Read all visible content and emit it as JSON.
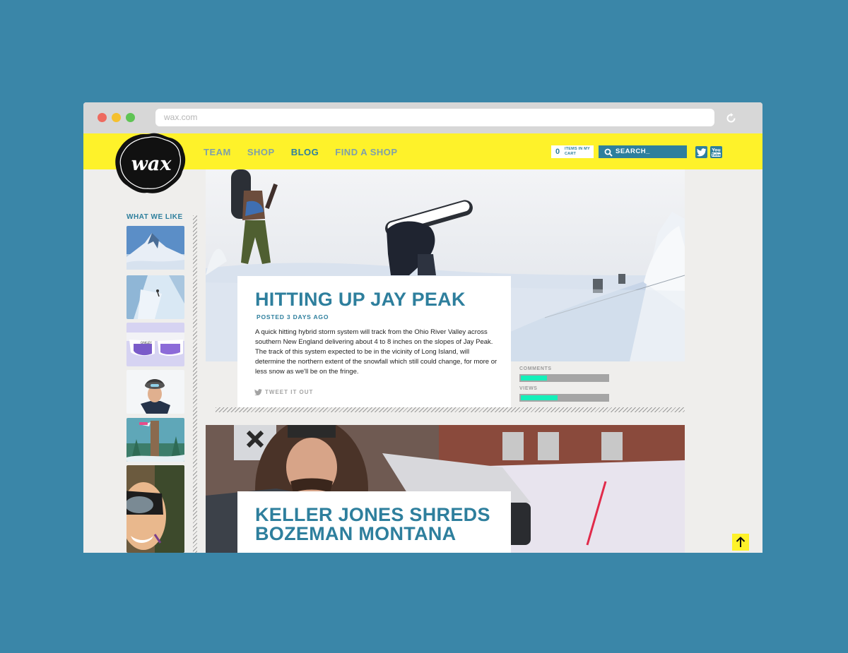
{
  "browser": {
    "url": "wax.com"
  },
  "header": {
    "logo_text": "wax",
    "nav": [
      {
        "label": "TEAM",
        "active": false
      },
      {
        "label": "SHOP",
        "active": false
      },
      {
        "label": "BLOG",
        "active": true
      },
      {
        "label": "FIND A SHOP",
        "active": false
      }
    ],
    "cart": {
      "count": "0",
      "label": "ITEMS IN MY CART"
    },
    "search": {
      "placeholder": "SEARCH_"
    },
    "social": [
      "twitter-icon",
      "youtube-icon"
    ]
  },
  "sidebar": {
    "title": "WHAT WE LIKE",
    "thumbnails": [
      "mountain-peak",
      "skier-on-slope",
      "oakley-sunglasses",
      "snowboarder-portrait",
      "snowboarder-in-trees",
      "goggles-closeup"
    ]
  },
  "posts": [
    {
      "title": "HITTING UP JAY PEAK",
      "meta": "POSTED 3 DAYS AGO",
      "body": "A quick hitting hybrid storm system will track from the Ohio River Valley across southern New England delivering about 4 to 8 inches on the slopes of Jay Peak. The track of this system expected to be in the vicinity of Long Island, will determine the northern extent of the snowfall which still could change, for more or less snow as we'll be on the fringe.",
      "tweet_label": "TWEET IT OUT",
      "stats": {
        "comments_label": "COMMENTS",
        "comments_fill": 0.3,
        "views_label": "VIEWS",
        "views_fill": 0.42
      }
    },
    {
      "title_line1": "KELLER JONES SHREDS",
      "title_line2": "BOZEMAN MONTANA"
    }
  ],
  "colors": {
    "background": "#3a86a8",
    "brand_yellow": "#fef22a",
    "brand_blue": "#2e7f9d",
    "accent_teal": "#14f0ba"
  }
}
